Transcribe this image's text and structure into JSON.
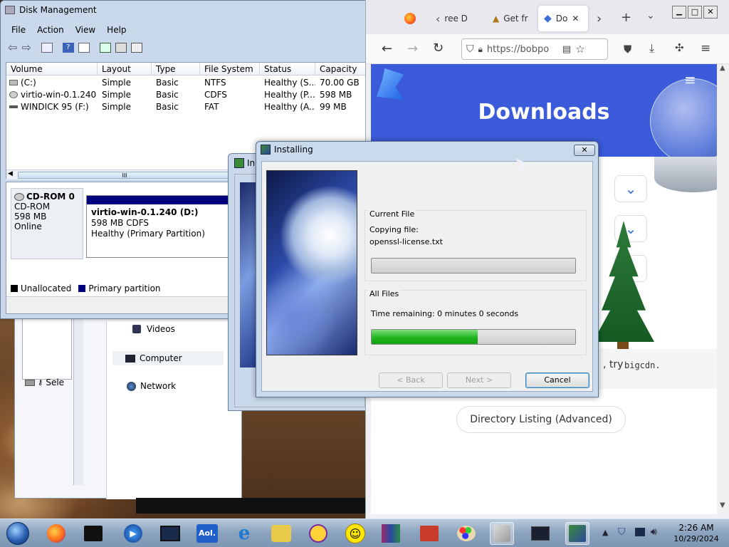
{
  "colors": {
    "firefox_accent": "#3b5bdb",
    "progress_green": "#1fb51f",
    "partition_blue": "#00007f"
  },
  "disk_mgmt": {
    "title": "Disk Management",
    "menu": [
      "File",
      "Action",
      "View",
      "Help"
    ],
    "columns": [
      "Volume",
      "Layout",
      "Type",
      "File System",
      "Status",
      "Capacity"
    ],
    "rows": [
      [
        "(C:)",
        "Simple",
        "Basic",
        "NTFS",
        "Healthy (S...",
        "70.00 GB"
      ],
      [
        "virtio-win-0.1.240 ...",
        "Simple",
        "Basic",
        "CDFS",
        "Healthy (P...",
        "598 MB"
      ],
      [
        "WINDICK 95 (F:)",
        "Simple",
        "Basic",
        "FAT",
        "Healthy (A...",
        "99 MB"
      ]
    ],
    "disk_label": "CD-ROM 0",
    "disk_type": "CD-ROM",
    "disk_size": "598 MB",
    "disk_state": "Online",
    "partition_name": "virtio-win-0.1.240  (D:)",
    "partition_size": "598 MB CDFS",
    "partition_status": "Healthy (Primary Partition)",
    "legend_unallocated": "Unallocated",
    "legend_primary": "Primary partition",
    "scroll_grip": "III"
  },
  "explorer": {
    "items": [
      "Videos",
      "Computer",
      "Network"
    ],
    "status_fragment": "Sele"
  },
  "installer_back": {
    "title_fragment": "In"
  },
  "installer": {
    "title": "Installing",
    "current_file_group": "Current File",
    "copying_label": "Copying file:",
    "file_name": "openssl-license.txt",
    "current_progress": 0,
    "all_files_group": "All Files",
    "time_remaining": "Time remaining: 0 minutes 0 seconds",
    "all_progress": 0.52,
    "back": "< Back",
    "next": "Next >",
    "cancel": "Cancel"
  },
  "firefox": {
    "tabs": [
      {
        "label": "ree D"
      },
      {
        "label": "Get fr"
      },
      {
        "label": "Do"
      }
    ],
    "url": "https://bobpo",
    "page_heading": "Downloads",
    "text_fragment_try": ", try",
    "text_fragment_cdn": "bigcdn.",
    "directory_button": "Directory Listing (Advanced)"
  },
  "taskbar": {
    "time": "2:26 AM",
    "date": "10/29/2024",
    "aol_label": "Aol."
  }
}
